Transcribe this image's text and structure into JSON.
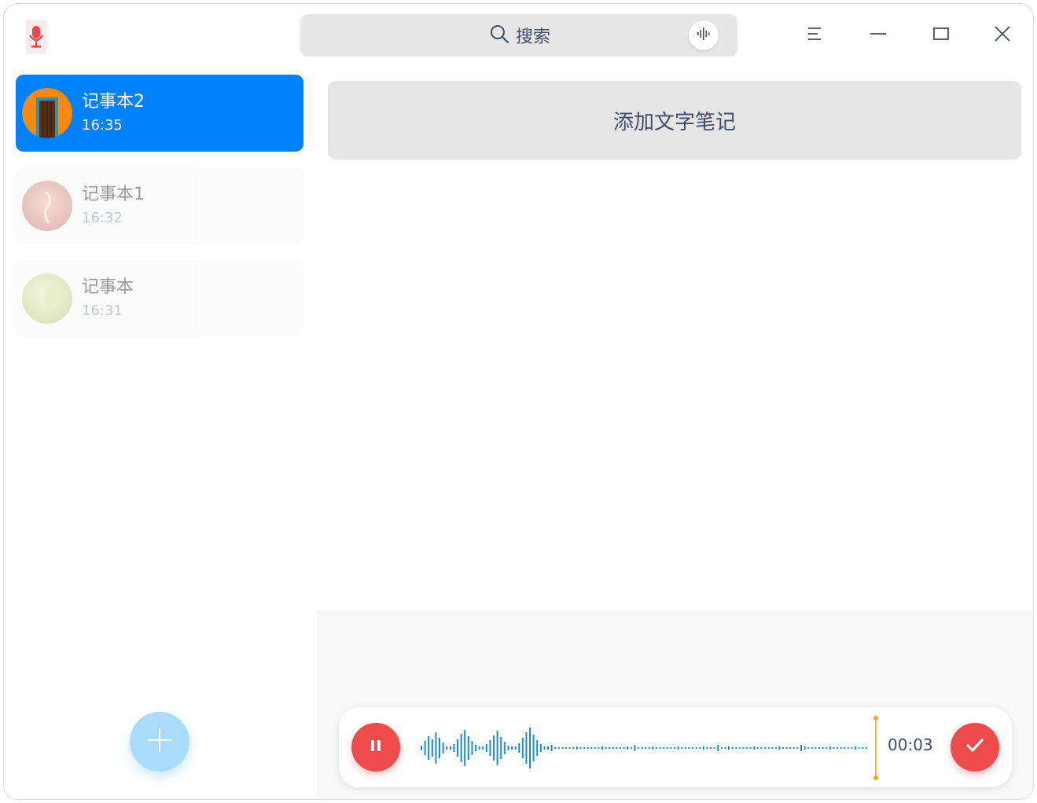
{
  "titlebar": {
    "app_icon": "microphone-icon",
    "search": {
      "placeholder": "搜索",
      "icon": "search-icon",
      "voice_icon": "voice-wave-icon"
    },
    "buttons": {
      "menu_icon": "menu-icon",
      "minimize_icon": "minimize-icon",
      "maximize_icon": "maximize-icon",
      "close_icon": "close-icon"
    }
  },
  "sidebar": {
    "notebooks": [
      {
        "name": "记事本2",
        "time": "16:35",
        "active": true
      },
      {
        "name": "记事本1",
        "time": "16:32",
        "active": false
      },
      {
        "name": "记事本",
        "time": "16:31",
        "active": false
      }
    ],
    "add_icon": "plus-icon"
  },
  "main": {
    "add_text_note_label": "添加文字笔记",
    "recorder": {
      "elapsed": "00:03",
      "pause_icon": "pause-icon",
      "done_icon": "check-icon"
    }
  },
  "colors": {
    "accent": "#0081ff",
    "record_red": "#ef4b4b",
    "wave_start": "#1aa6c7",
    "wave_end": "#1e6fd9",
    "cursor": "#f5a623"
  }
}
